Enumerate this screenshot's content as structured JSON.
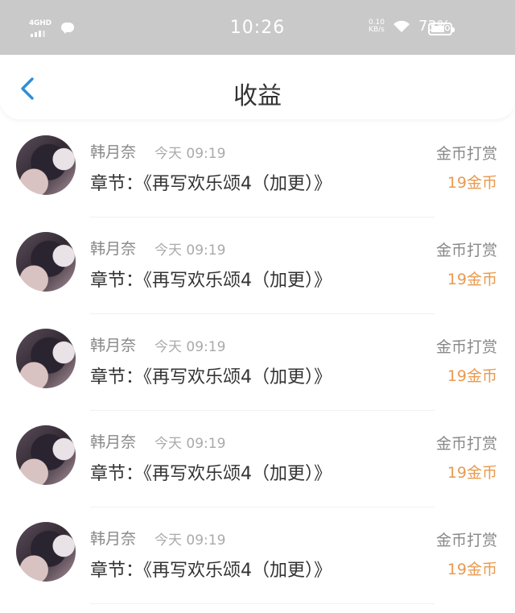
{
  "status_bar": {
    "network": "4GHD",
    "time": "10:26",
    "speed_value": "0.10",
    "speed_unit": "KB/s",
    "battery_percent": "73%",
    "battery_level": 0.73,
    "icons": [
      "signal-icon",
      "chat-icon",
      "wifi-icon",
      "battery-icon"
    ]
  },
  "header": {
    "back_icon": "back-arrow-icon",
    "title": "收益"
  },
  "colors": {
    "status_bar_bg": "#c9c9c9",
    "accent_blue": "#2c8fd8",
    "amount_orange": "#e89a4f",
    "primary_text": "#333333",
    "secondary_text": "#888888"
  },
  "records": [
    {
      "name": "韩月奈",
      "time": "今天 09:19",
      "chapter": "章节：《再写欢乐颂4（加更）》",
      "type": "金币打赏",
      "amount": "19金币"
    },
    {
      "name": "韩月奈",
      "time": "今天 09:19",
      "chapter": "章节：《再写欢乐颂4（加更）》",
      "type": "金币打赏",
      "amount": "19金币"
    },
    {
      "name": "韩月奈",
      "time": "今天 09:19",
      "chapter": "章节：《再写欢乐颂4（加更）》",
      "type": "金币打赏",
      "amount": "19金币"
    },
    {
      "name": "韩月奈",
      "time": "今天 09:19",
      "chapter": "章节：《再写欢乐颂4（加更）》",
      "type": "金币打赏",
      "amount": "19金币"
    },
    {
      "name": "韩月奈",
      "time": "今天 09:19",
      "chapter": "章节：《再写欢乐颂4（加更）》",
      "type": "金币打赏",
      "amount": "19金币"
    }
  ]
}
